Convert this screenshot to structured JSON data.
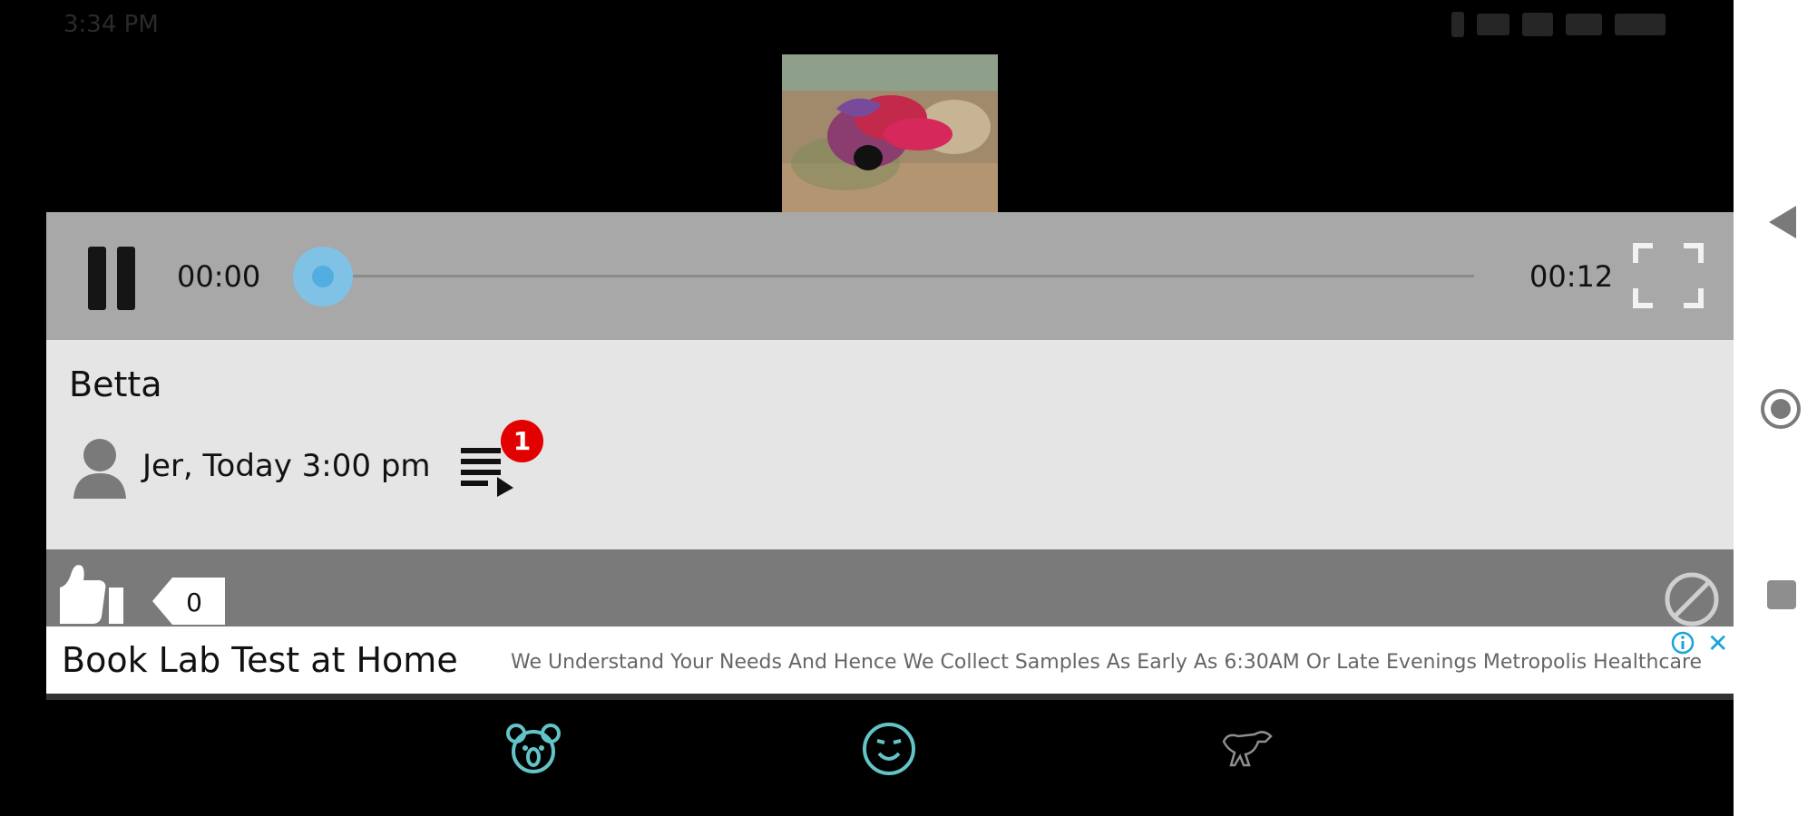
{
  "status_bar": {
    "time": "3:34 PM"
  },
  "media": {
    "thumbnail_icon": "betta-fish-thumbnail",
    "current_time": "00:00",
    "duration": "00:12",
    "progress": 0.0
  },
  "post": {
    "title": "Betta",
    "author_meta": "Jer, Today 3:00 pm",
    "playlist_badge": "1"
  },
  "actions": {
    "like_count": "0"
  },
  "ad": {
    "title": "Book Lab Test at Home",
    "text": "We Understand Your Needs And Hence We Collect Samples As Early As 6:30AM Or Late Evenings Metropolis Healthcare",
    "close": "✕"
  },
  "bottom_nav": [
    {
      "icon": "koala-icon"
    },
    {
      "icon": "smiley-icon"
    },
    {
      "icon": "dinosaur-icon"
    }
  ],
  "colors": {
    "accent": "#63c4c7",
    "knob": "#52aee0",
    "badge": "#e20000"
  }
}
